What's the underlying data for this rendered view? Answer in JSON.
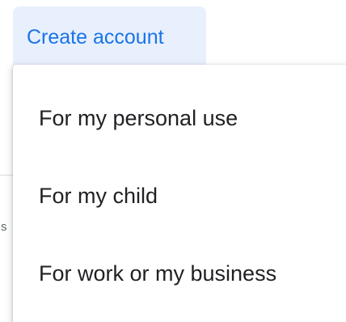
{
  "create_account": {
    "label": "Create account"
  },
  "menu": {
    "items": [
      {
        "label": "For my personal use"
      },
      {
        "label": "For my child"
      },
      {
        "label": "For work or my business"
      }
    ]
  },
  "background": {
    "fragment_text": "s"
  },
  "colors": {
    "accent": "#1a73e8",
    "button_bg": "#e8f0fe",
    "text": "#202124"
  }
}
